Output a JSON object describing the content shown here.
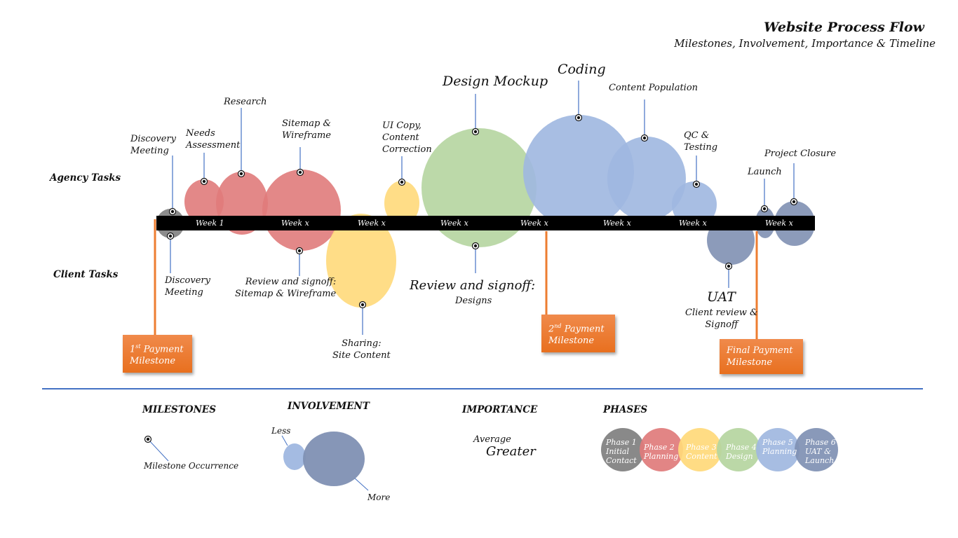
{
  "header": {
    "title": "Website Process Flow",
    "subtitle": "Milestones, Involvement, Importance & Timeline"
  },
  "rows": {
    "agency": "Agency Tasks",
    "client": "Client Tasks"
  },
  "timeline": {
    "weeks": [
      "Week 1",
      "Week x",
      "Week x",
      "Week x",
      "Week x",
      "Week x",
      "Week x",
      "Week x"
    ]
  },
  "colors": {
    "phase1": "#7f7f7f",
    "phase2": "#e07b7b",
    "phase3": "#ffd97a",
    "phase4": "#b5d5a0",
    "phase5": "#9fb7e0",
    "phase6": "#7f90b3",
    "milestone_line": "#4472c4",
    "payment": "#ed7d31",
    "divider": "#4472c4"
  },
  "agency_tasks": [
    {
      "label": "Discovery\nMeeting",
      "phase": 1
    },
    {
      "label": "Needs\nAssessment",
      "phase": 2
    },
    {
      "label": "Research",
      "phase": 2
    },
    {
      "label": "Sitemap &\nWireframe",
      "phase": 2
    },
    {
      "label": "UI Copy,\nContent\nCorrection",
      "phase": 3
    },
    {
      "label": "Design Mockup",
      "phase": 4
    },
    {
      "label": "Coding",
      "phase": 5
    },
    {
      "label": "Content Population",
      "phase": 5
    },
    {
      "label": "QC &\nTesting",
      "phase": 5
    },
    {
      "label": "Launch",
      "phase": 6
    },
    {
      "label": "Project Closure",
      "phase": 6
    }
  ],
  "client_tasks": [
    {
      "label": "Discovery\nMeeting",
      "phase": 1
    },
    {
      "label": "Review and signoff:\nSitemap & Wireframe",
      "phase": 2
    },
    {
      "label": "Sharing:\nSite Content",
      "phase": 3
    },
    {
      "label": "Review and signoff:",
      "sublabel": "Designs",
      "phase": 4
    },
    {
      "label": "UAT",
      "sublabel": "Client review &\nSignoff",
      "phase": 6
    }
  ],
  "payments": [
    {
      "sup": "st",
      "num": "1",
      "label": "Payment\nMilestone"
    },
    {
      "sup": "nd",
      "num": "2",
      "label": "Payment\nMilestone"
    },
    {
      "label": "Final Payment\nMilestone"
    }
  ],
  "legend": {
    "milestones": {
      "title": "MILESTONES",
      "item": "Milestone Occurrence"
    },
    "involvement": {
      "title": "INVOLVEMENT",
      "less": "Less",
      "more": "More"
    },
    "importance": {
      "title": "IMPORTANCE",
      "average": "Average",
      "greater": "Greater"
    },
    "phases": {
      "title": "PHASES",
      "items": [
        "Phase 1\nInitial\nContact",
        "Phase 2\nPlanning",
        "Phase 3\nContent",
        "Phase 4\nDesign",
        "Phase 5\nPlanning",
        "Phase 6\nUAT &\nLaunch"
      ]
    }
  }
}
